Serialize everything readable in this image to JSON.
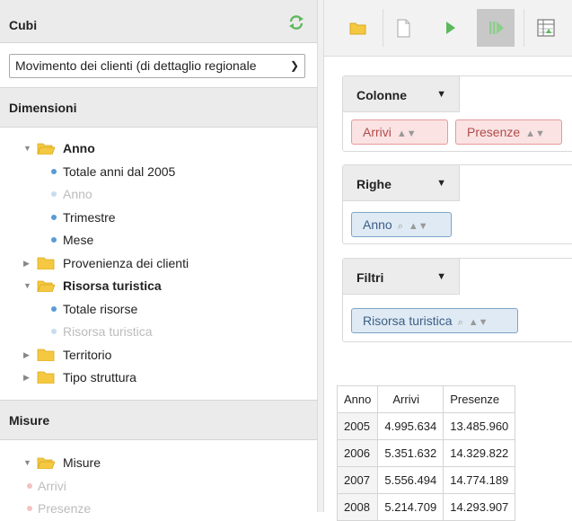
{
  "cubi": {
    "title": "Cubi",
    "selected": "Movimento dei clienti (di dettaglio regionale"
  },
  "dimensioni": {
    "title": "Dimensioni",
    "tree": [
      {
        "label": "Anno",
        "kind": "folder-open",
        "bold": true
      },
      {
        "label": "Totale anni dal 2005",
        "kind": "leaf"
      },
      {
        "label": "Anno",
        "kind": "leaf-disabled"
      },
      {
        "label": "Trimestre",
        "kind": "leaf"
      },
      {
        "label": "Mese",
        "kind": "leaf"
      },
      {
        "label": "Provenienza dei clienti",
        "kind": "folder-closed"
      },
      {
        "label": "Risorsa turistica",
        "kind": "folder-open",
        "bold": true
      },
      {
        "label": "Totale risorse",
        "kind": "leaf"
      },
      {
        "label": "Risorsa turistica",
        "kind": "leaf-disabled"
      },
      {
        "label": "Territorio",
        "kind": "folder-closed"
      },
      {
        "label": "Tipo struttura",
        "kind": "folder-closed"
      }
    ]
  },
  "misure": {
    "title": "Misure",
    "tree": [
      {
        "label": "Misure",
        "kind": "folder-open"
      },
      {
        "label": "Arrivi",
        "kind": "measure-disabled"
      },
      {
        "label": "Presenze",
        "kind": "measure-disabled"
      }
    ]
  },
  "zones": {
    "colonne": {
      "title": "Colonne",
      "pills": [
        "Arrivi",
        "Presenze"
      ]
    },
    "righe": {
      "title": "Righe",
      "pills": [
        "Anno"
      ]
    },
    "filtri": {
      "title": "Filtri",
      "pills": [
        "Risorsa turistica"
      ]
    }
  },
  "table": {
    "headers": [
      "Anno",
      "Arrivi",
      "Presenze"
    ],
    "rows": [
      [
        "2005",
        "4.995.634",
        "13.485.960"
      ],
      [
        "2006",
        "5.351.632",
        "14.329.822"
      ],
      [
        "2007",
        "5.556.494",
        "14.774.189"
      ],
      [
        "2008",
        "5.214.709",
        "14.293.907"
      ]
    ]
  },
  "colors": {
    "green_icon": "#5cb85c",
    "folder": "#f5c842",
    "dot_blue": "#5b9bd5",
    "dot_pink": "#f2a3a3"
  }
}
